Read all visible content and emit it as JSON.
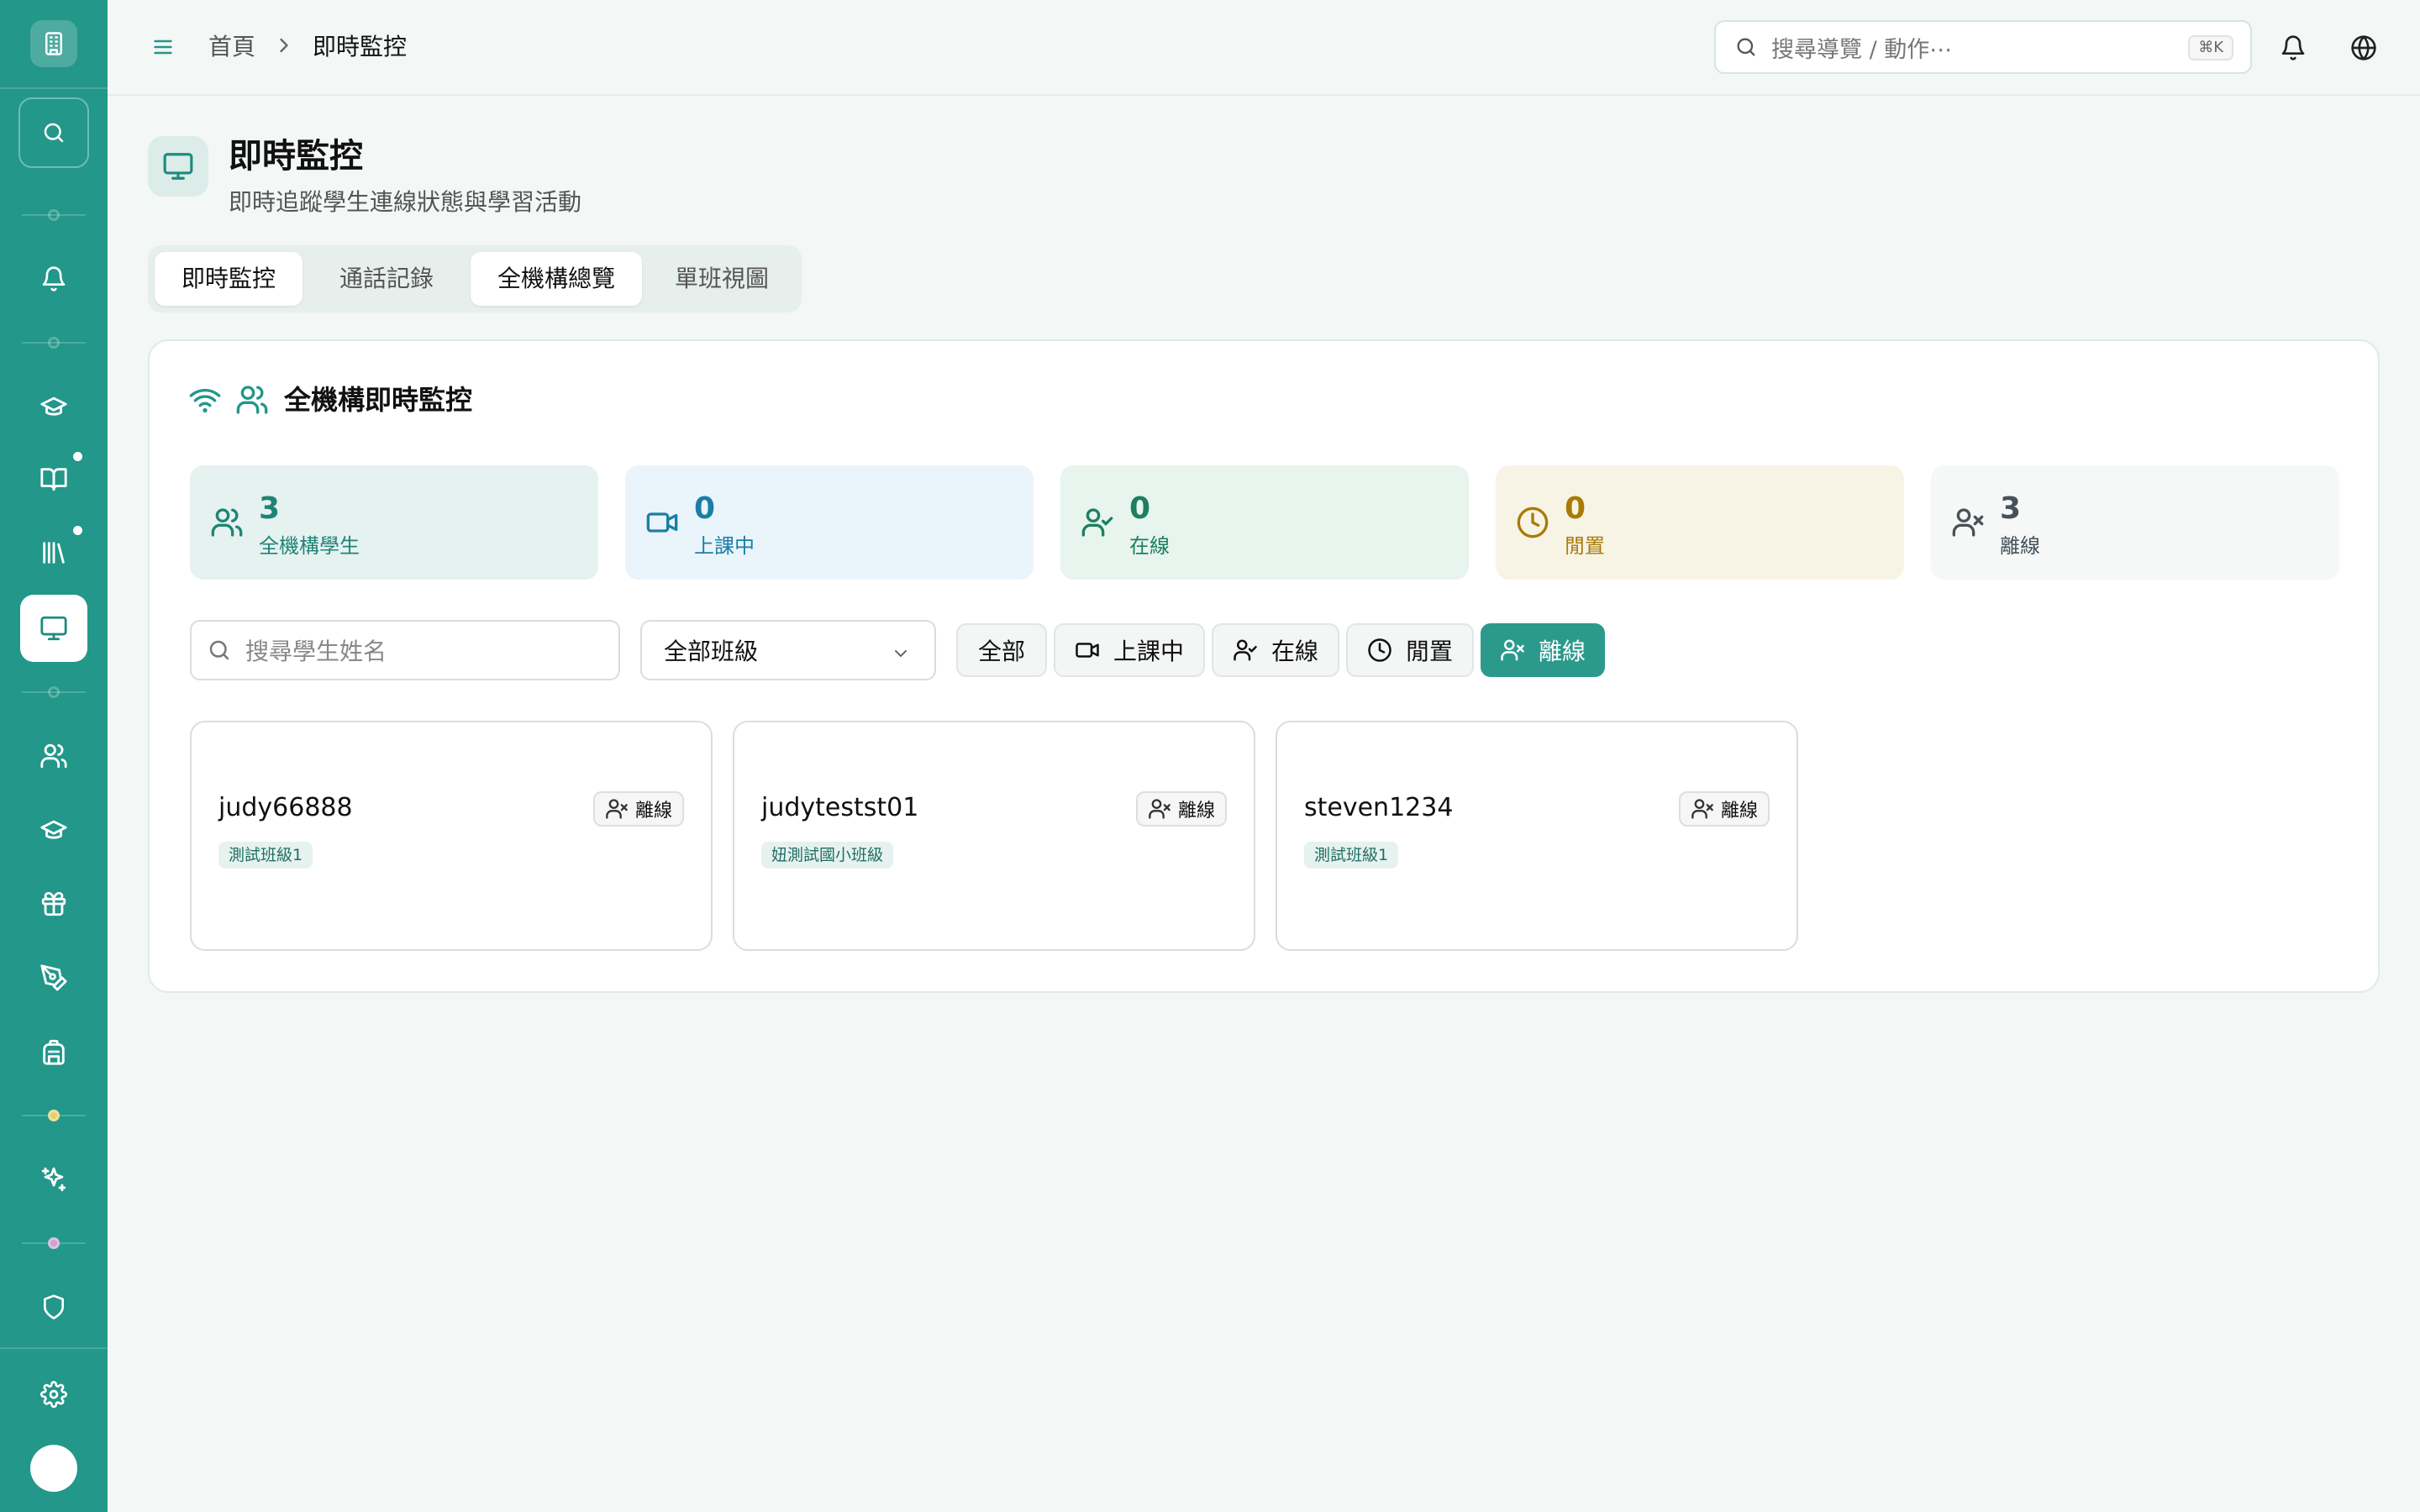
{
  "header": {
    "breadcrumb": [
      "首頁",
      "即時監控"
    ],
    "search_placeholder": "搜尋導覽 / 動作⋯",
    "search_shortcut": "⌘K"
  },
  "page": {
    "title": "即時監控",
    "subtitle": "即時追蹤學生連線狀態與學習活動"
  },
  "tabs": [
    {
      "label": "即時監控",
      "selected": true
    },
    {
      "label": "通話記錄",
      "selected": false
    },
    {
      "label": "全機構總覽",
      "selected": true
    },
    {
      "label": "單班視圖",
      "selected": false
    }
  ],
  "panel": {
    "title": "全機構即時監控",
    "stats": [
      {
        "value": "3",
        "label": "全機構學生",
        "icon": "users-icon",
        "bg": "#e5f2ef",
        "color": "#1f8477"
      },
      {
        "value": "0",
        "label": "上課中",
        "icon": "video-icon",
        "bg": "#eaf4fb",
        "color": "#1a7fa6"
      },
      {
        "value": "0",
        "label": "在線",
        "icon": "user-check-icon",
        "bg": "#e8f4ee",
        "color": "#1c7f60"
      },
      {
        "value": "0",
        "label": "閒置",
        "icon": "clock-icon",
        "bg": "#f8f4e5",
        "color": "#a87b06"
      },
      {
        "value": "3",
        "label": "離線",
        "icon": "user-x-icon",
        "bg": "#f6f8f8",
        "color": "#475259"
      }
    ],
    "student_search_placeholder": "搜尋學生姓名",
    "class_filter": "全部班級",
    "filters": [
      {
        "label": "全部",
        "active": false
      },
      {
        "label": "上課中",
        "active": false
      },
      {
        "label": "在線",
        "active": false
      },
      {
        "label": "閒置",
        "active": false
      },
      {
        "label": "離線",
        "active": true
      }
    ],
    "students": [
      {
        "name": "judy66888",
        "status": "離線",
        "class": "測試班級1"
      },
      {
        "name": "judytestst01",
        "status": "離線",
        "class": "妞測試國小班級"
      },
      {
        "name": "steven1234",
        "status": "離線",
        "class": "測試班級1"
      }
    ]
  }
}
